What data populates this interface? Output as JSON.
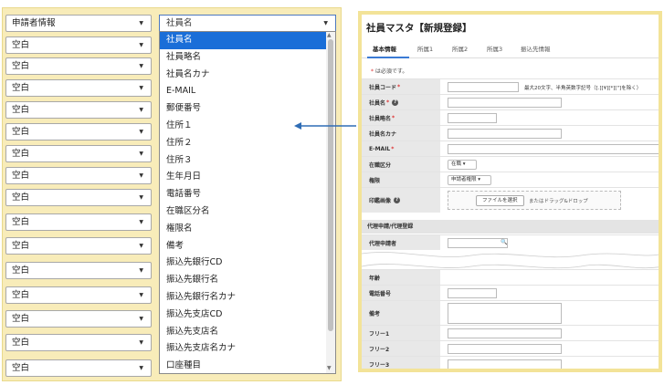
{
  "left_panel": {
    "first_select": "申請者情報",
    "blank_selects": [
      "空白",
      "空白",
      "空白",
      "空白",
      "空白",
      "空白",
      "空白",
      "空白",
      "空白",
      "空白",
      "空白",
      "空白",
      "空白",
      "空白",
      "空白"
    ],
    "target_select": "社員名",
    "options": [
      "社員名",
      "社員略名",
      "社員名カナ",
      "E-MAIL",
      "郵便番号",
      "住所１",
      "住所２",
      "住所３",
      "生年月日",
      "電話番号",
      "在職区分名",
      "権限名",
      "備考",
      "振込先銀行CD",
      "振込先銀行名",
      "振込先銀行名カナ",
      "振込先支店CD",
      "振込先支店名",
      "振込先支店名カナ",
      "口座種目"
    ],
    "active_option_index": 0
  },
  "right_panel": {
    "title": "社員マスタ【新規登録】",
    "tabs": [
      "基本情報",
      "所属1",
      "所属2",
      "所属3",
      "振込先情報"
    ],
    "required_note": "は必須です。",
    "required_mark": "*",
    "fields": {
      "code": "社員コード",
      "code_note": "最大20文字、半角英数字記号（[.][¥][*][\"]を除く）",
      "name": "社員名",
      "short": "社員略名",
      "kana": "社員名カナ",
      "email": "E-MAIL",
      "status": "在職区分",
      "status_value": "在職",
      "role": "権限",
      "role_value": "申請者権限",
      "seal": "印鑑画像",
      "file_button": "ファイルを選択",
      "drop_text": "またはドラッグ&ドロップ",
      "proxy_section": "代理申請/代理登録",
      "proxy": "代理申請者",
      "age": "年齢",
      "phone": "電話番号",
      "memo": "備考",
      "free1": "フリー1",
      "free2": "フリー2",
      "free3": "フリー3"
    }
  },
  "colors": {
    "accent": "#1a6ed8",
    "panel_bg": "#f8ecb9",
    "required": "#dd3333",
    "arrow": "#2f6db5"
  }
}
